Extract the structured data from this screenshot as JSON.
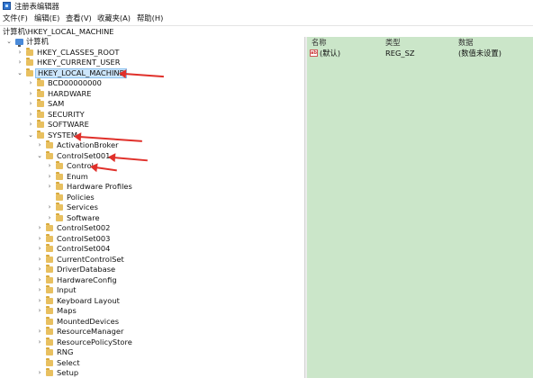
{
  "window": {
    "title": "注册表编辑器",
    "icon": "regedit-icon"
  },
  "menu": [
    {
      "label": "文件(F)"
    },
    {
      "label": "编辑(E)"
    },
    {
      "label": "查看(V)"
    },
    {
      "label": "收藏夹(A)"
    },
    {
      "label": "帮助(H)"
    }
  ],
  "address": "计算机\\HKEY_LOCAL_MACHINE",
  "tree": {
    "root": {
      "label": "计算机",
      "icon": "computer-icon"
    },
    "nodes": [
      {
        "label": "HKEY_CLASSES_ROOT"
      },
      {
        "label": "HKEY_CURRENT_USER"
      },
      {
        "label": "HKEY_LOCAL_MACHINE",
        "selected": true
      },
      {
        "label": "BCD00000000"
      },
      {
        "label": "HARDWARE"
      },
      {
        "label": "SAM"
      },
      {
        "label": "SECURITY"
      },
      {
        "label": "SOFTWARE"
      },
      {
        "label": "SYSTEM"
      },
      {
        "label": "ActivationBroker"
      },
      {
        "label": "ControlSet001"
      },
      {
        "label": "Control"
      },
      {
        "label": "Enum"
      },
      {
        "label": "Hardware Profiles"
      },
      {
        "label": "Policies"
      },
      {
        "label": "Services"
      },
      {
        "label": "Software"
      },
      {
        "label": "ControlSet002"
      },
      {
        "label": "ControlSet003"
      },
      {
        "label": "ControlSet004"
      },
      {
        "label": "CurrentControlSet"
      },
      {
        "label": "DriverDatabase"
      },
      {
        "label": "HardwareConfig"
      },
      {
        "label": "Input"
      },
      {
        "label": "Keyboard Layout"
      },
      {
        "label": "Maps"
      },
      {
        "label": "MountedDevices"
      },
      {
        "label": "ResourceManager"
      },
      {
        "label": "ResourcePolicyStore"
      },
      {
        "label": "RNG"
      },
      {
        "label": "Select"
      },
      {
        "label": "Setup"
      }
    ]
  },
  "values_pane": {
    "columns": {
      "name": "名称",
      "type": "类型",
      "data": "数据"
    },
    "rows": [
      {
        "name": "(默认)",
        "type": "REG_SZ",
        "data": "(数值未设置)",
        "icon": "string-value-icon"
      }
    ]
  },
  "colors": {
    "values_background": "#cbe6c9",
    "annotation_arrow": "#e0302a",
    "selection": "#cde6fb"
  }
}
